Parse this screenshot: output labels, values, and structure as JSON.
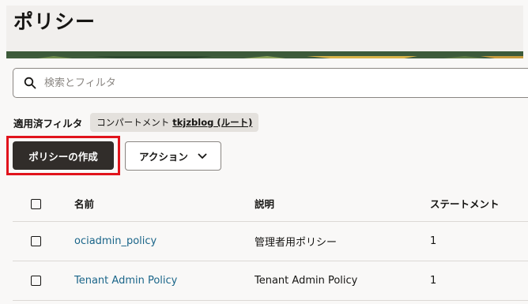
{
  "page": {
    "title": "ポリシー"
  },
  "search": {
    "placeholder": "検索とフィルタ"
  },
  "filters": {
    "label": "適用済フィルタ",
    "chip_key": "コンパートメント",
    "chip_value": "tkjzblog (ルート)"
  },
  "toolbar": {
    "create_label": "ポリシーの作成",
    "actions_label": "アクション"
  },
  "table": {
    "columns": [
      "名前",
      "説明",
      "ステートメント"
    ],
    "rows": [
      {
        "name": "ociadmin_policy",
        "description": "管理者用ポリシー",
        "statements": "1"
      },
      {
        "name": "Tenant Admin Policy",
        "description": "Tenant Admin Policy",
        "statements": "1"
      }
    ]
  },
  "colors": {
    "primary_button": "#312d2a",
    "link": "#1a6589",
    "highlight_border": "#e1131c"
  }
}
